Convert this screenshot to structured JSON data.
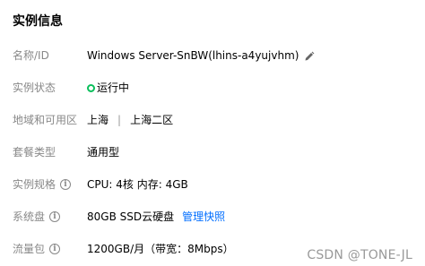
{
  "section": {
    "title": "实例信息"
  },
  "rows": {
    "name": {
      "label": "名称/ID",
      "value": "Windows Server-SnBW(lhins-a4yujvhm)",
      "edit_icon": "pencil-icon"
    },
    "status": {
      "label": "实例状态",
      "value": "运行中",
      "status_color": "#0abf5b"
    },
    "region": {
      "label": "地域和可用区",
      "region": "上海",
      "separator": "|",
      "zone": "上海二区"
    },
    "package_type": {
      "label": "套餐类型",
      "value": "通用型"
    },
    "spec": {
      "label": "实例规格",
      "info_icon": "info-icon",
      "value": "CPU: 4核 内存: 4GB"
    },
    "system_disk": {
      "label": "系统盘",
      "info_icon": "info-icon",
      "value": "80GB SSD云硬盘",
      "link": "管理快照"
    },
    "traffic": {
      "label": "流量包",
      "info_icon": "info-icon",
      "value": "1200GB/月（带宽：8Mbps）"
    }
  },
  "watermark": "CSDN @TONE-JL",
  "colors": {
    "label": "#888888",
    "link": "#006eff",
    "running": "#0abf5b"
  }
}
